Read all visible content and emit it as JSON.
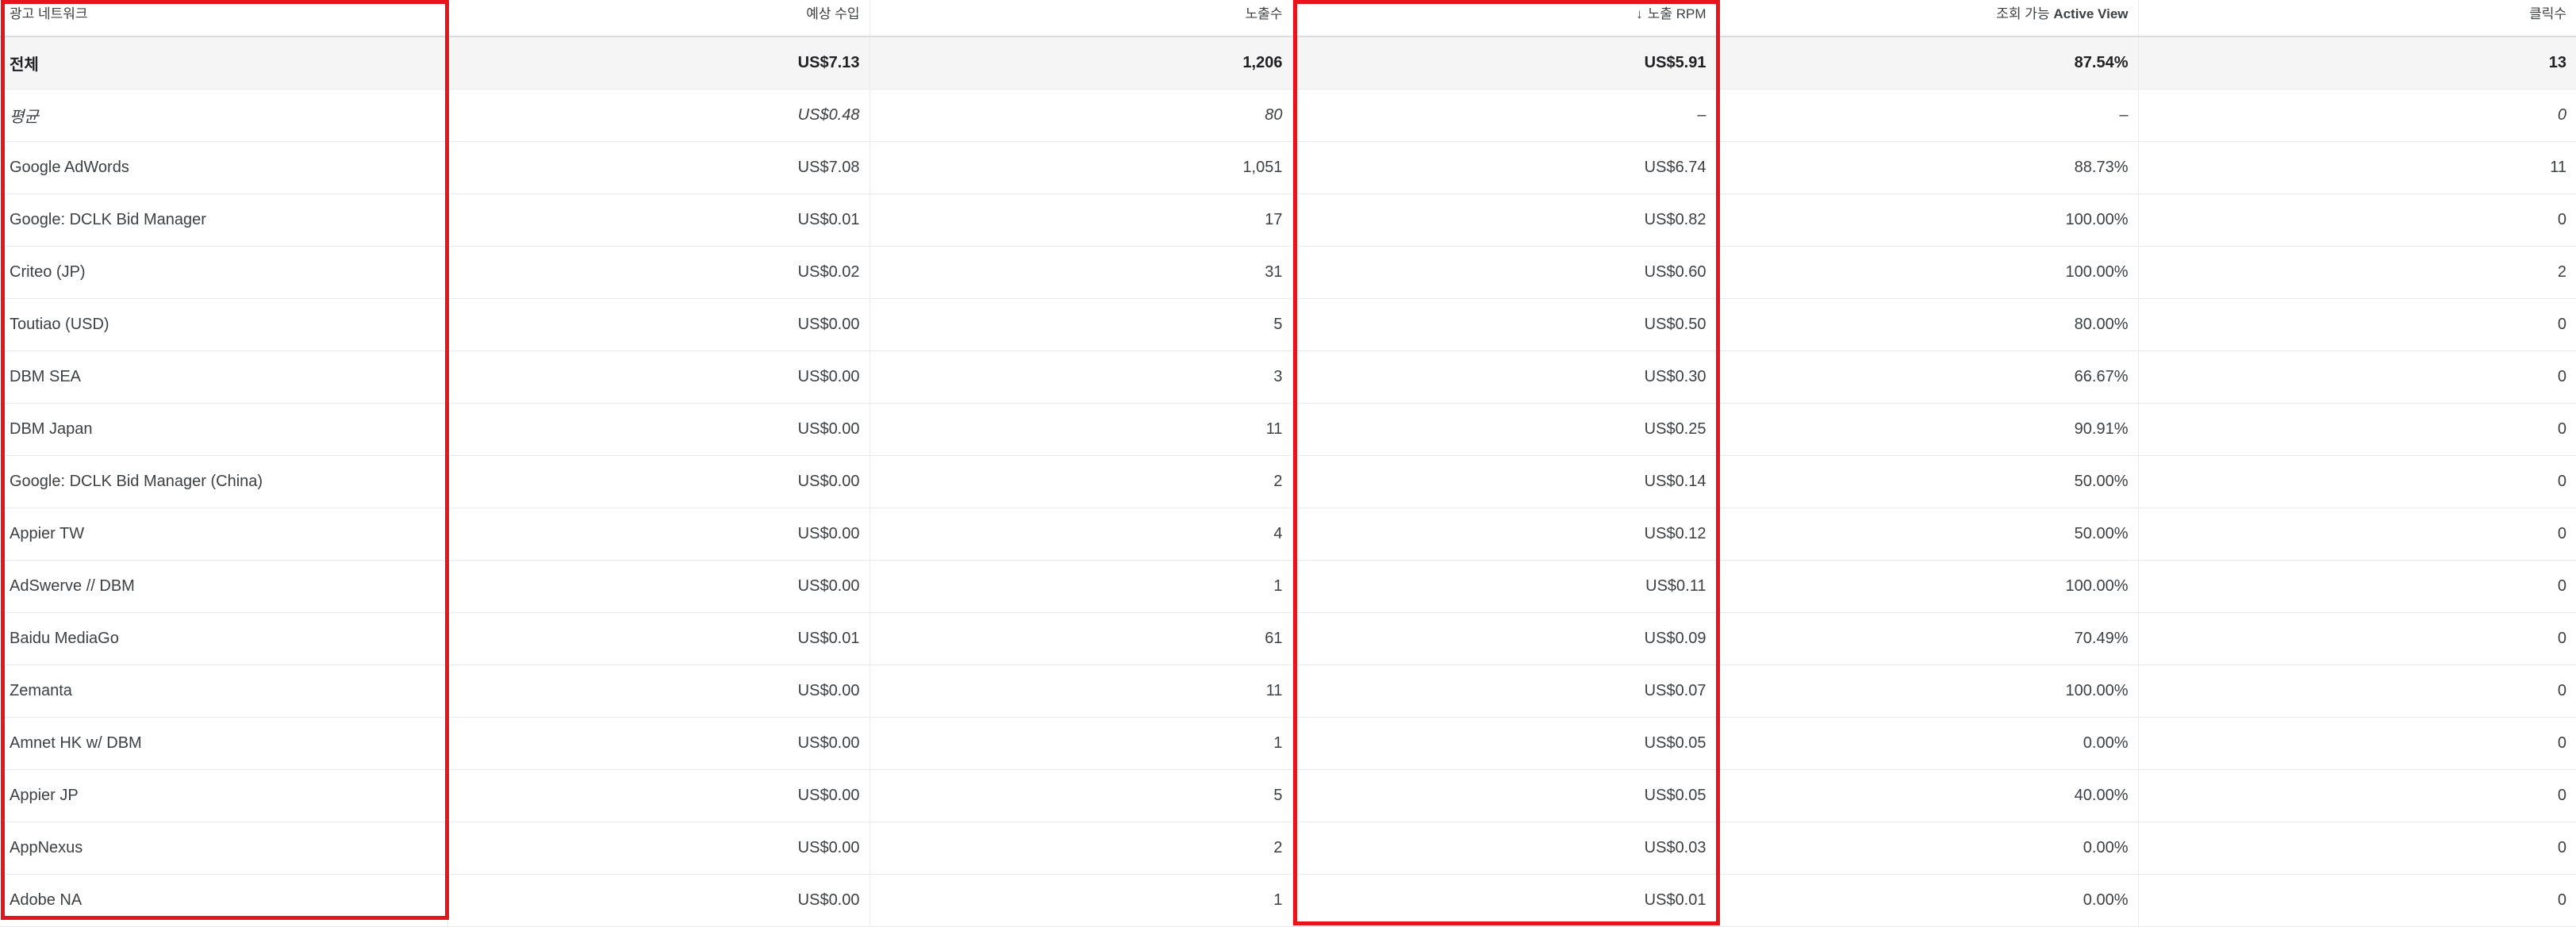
{
  "table": {
    "headers": [
      {
        "label": "광고 네트워크"
      },
      {
        "label": "예상 수입"
      },
      {
        "label": "노출수"
      },
      {
        "label": "노출 RPM",
        "sort_icon": "arrow-down-icon",
        "sort_glyph": "↓"
      },
      {
        "label_prefix": "조회 가능 ",
        "label_strong": "Active View"
      },
      {
        "label": "클릭수"
      }
    ],
    "total": [
      "전체",
      "US$7.13",
      "1,206",
      "US$5.91",
      "87.54%",
      "13"
    ],
    "average": [
      "평균",
      "US$0.48",
      "80",
      "–",
      "–",
      "0"
    ],
    "rows": [
      [
        "Google AdWords",
        "US$7.08",
        "1,051",
        "US$6.74",
        "88.73%",
        "11"
      ],
      [
        "Google: DCLK Bid Manager",
        "US$0.01",
        "17",
        "US$0.82",
        "100.00%",
        "0"
      ],
      [
        "Criteo (JP)",
        "US$0.02",
        "31",
        "US$0.60",
        "100.00%",
        "2"
      ],
      [
        "Toutiao (USD)",
        "US$0.00",
        "5",
        "US$0.50",
        "80.00%",
        "0"
      ],
      [
        "DBM SEA",
        "US$0.00",
        "3",
        "US$0.30",
        "66.67%",
        "0"
      ],
      [
        "DBM Japan",
        "US$0.00",
        "11",
        "US$0.25",
        "90.91%",
        "0"
      ],
      [
        "Google: DCLK Bid Manager (China)",
        "US$0.00",
        "2",
        "US$0.14",
        "50.00%",
        "0"
      ],
      [
        "Appier TW",
        "US$0.00",
        "4",
        "US$0.12",
        "50.00%",
        "0"
      ],
      [
        "AdSwerve // DBM",
        "US$0.00",
        "1",
        "US$0.11",
        "100.00%",
        "0"
      ],
      [
        "Baidu MediaGo",
        "US$0.01",
        "61",
        "US$0.09",
        "70.49%",
        "0"
      ],
      [
        "Zemanta",
        "US$0.00",
        "11",
        "US$0.07",
        "100.00%",
        "0"
      ],
      [
        "Amnet HK w/ DBM",
        "US$0.00",
        "1",
        "US$0.05",
        "0.00%",
        "0"
      ],
      [
        "Appier JP",
        "US$0.00",
        "5",
        "US$0.05",
        "40.00%",
        "0"
      ],
      [
        "AppNexus",
        "US$0.00",
        "2",
        "US$0.03",
        "0.00%",
        "0"
      ],
      [
        "Adobe NA",
        "US$0.00",
        "1",
        "US$0.01",
        "0.00%",
        "0"
      ]
    ]
  },
  "highlight": {
    "color": "#e8141c",
    "columns": [
      "광고 네트워크",
      "노출 RPM"
    ]
  }
}
